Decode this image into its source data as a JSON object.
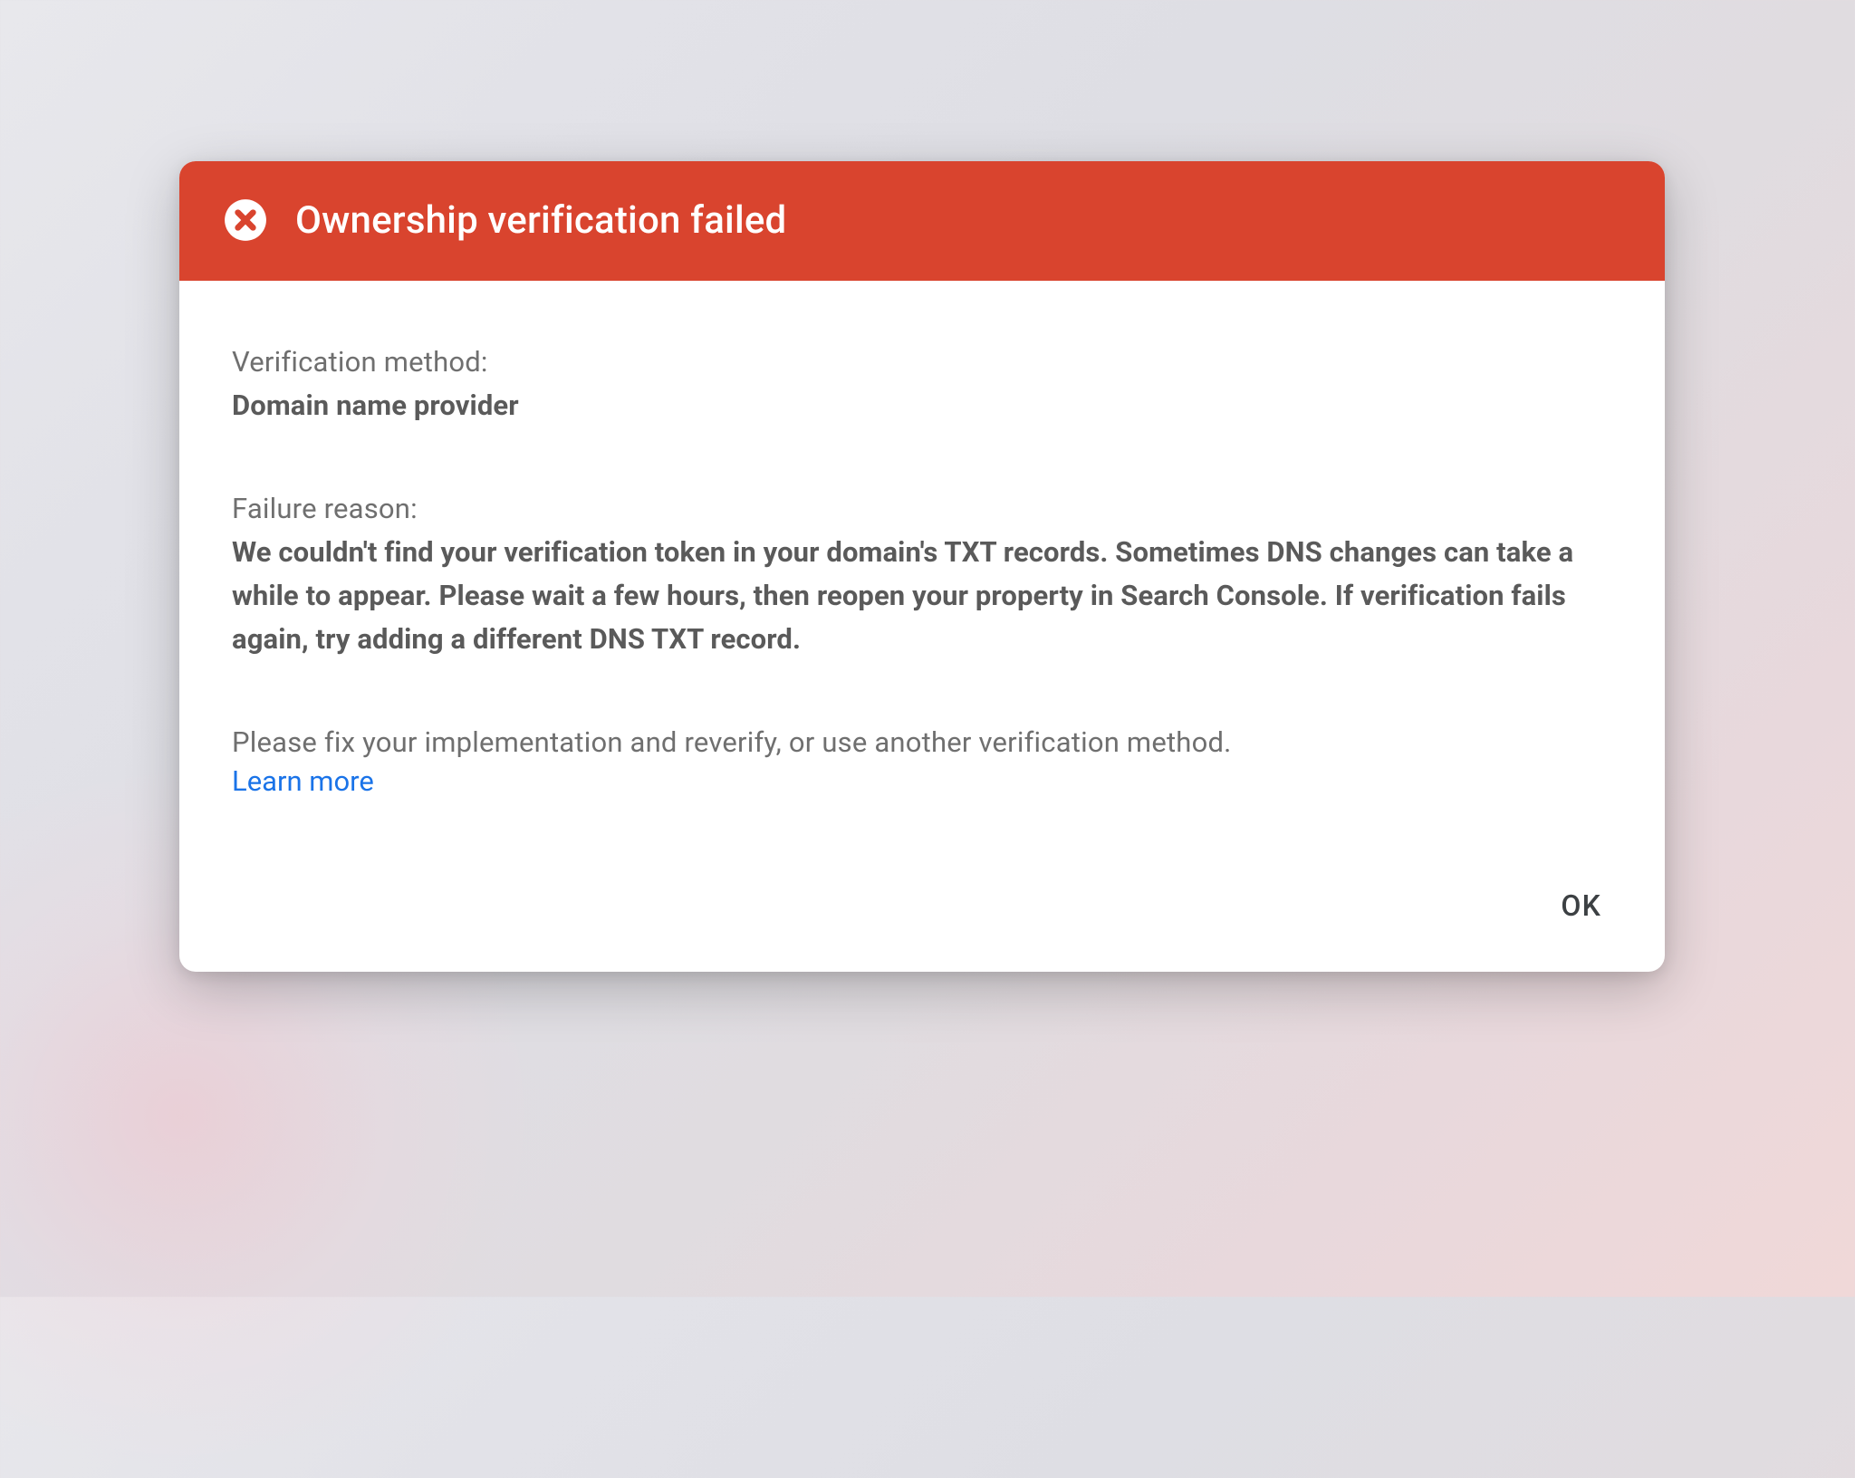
{
  "dialog": {
    "title": "Ownership verification failed",
    "method_label": "Verification method:",
    "method_value": "Domain name provider",
    "reason_label": "Failure reason:",
    "reason_value": "We couldn't find your verification token in your domain's TXT records. Sometimes DNS changes can take a while to appear. Please wait a few hours, then reopen your property in Search Console. If verification fails again, try adding a different DNS TXT record.",
    "help_text": "Please fix your implementation and reverify, or use another verification method.",
    "learn_more": "Learn more",
    "ok_label": "OK"
  },
  "colors": {
    "header_bg": "#d9442e",
    "link": "#1a73e8"
  }
}
